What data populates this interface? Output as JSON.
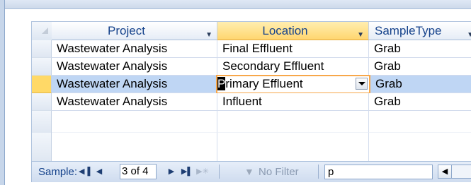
{
  "columns": [
    {
      "label": "Project"
    },
    {
      "label": "Location"
    },
    {
      "label": "SampleType"
    }
  ],
  "rows": [
    {
      "project": "Wastewater Analysis",
      "location": "Final Effluent",
      "sample_type": "Grab"
    },
    {
      "project": "Wastewater Analysis",
      "location": "Secondary Effluent",
      "sample_type": "Grab"
    },
    {
      "project": "Wastewater Analysis",
      "location_caret": "P",
      "location_rest": "rimary Effluent",
      "sample_type": "Grab"
    },
    {
      "project": "Wastewater Analysis",
      "location": "Influent",
      "sample_type": "Grab"
    }
  ],
  "navigation": {
    "label": "Sample:",
    "first_icon": "first-record-icon",
    "prev_icon": "previous-record-icon",
    "counter": "3 of 4",
    "next_icon": "next-record-icon",
    "last_icon": "last-record-icon",
    "new_icon": "new-record-icon",
    "filter_icon": "no-filter-icon",
    "filter_label": "No Filter",
    "search_value": "p"
  },
  "colors": {
    "header_text": "#15428b",
    "active_header": "#ffd66f",
    "current_row": "#bfd6f4",
    "edit_border": "#f7a74a"
  }
}
